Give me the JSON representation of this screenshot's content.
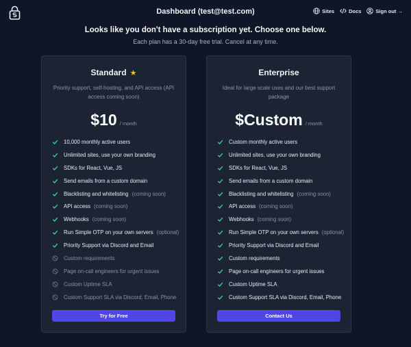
{
  "nav": {
    "title": "Dashboard (test@test.com)",
    "links": [
      {
        "label": "Sites",
        "icon": "globe-icon"
      },
      {
        "label": "Docs",
        "icon": "code-icon"
      },
      {
        "label": "Sign out →",
        "icon": "user-circle-icon"
      }
    ]
  },
  "header": {
    "headline": "Looks like you don't have a subscription yet. Choose one below.",
    "subline": "Each plan has a 30-day free trial. Cancel at any time."
  },
  "colors": {
    "background": "#0f1628",
    "card": "#1c2433",
    "accent": "#4f46e5",
    "check": "#34d399",
    "star": "#f5c518"
  },
  "plans": [
    {
      "name": "Standard",
      "badge_icon": "star-icon",
      "description": "Priority support, self-hosting, and API access (API access coming soon)",
      "price": "$10",
      "period": "/ month",
      "features": [
        {
          "label": "10,000 monthly active users",
          "included": true,
          "note": ""
        },
        {
          "label": "Unlimited sites, use your own branding",
          "included": true,
          "note": ""
        },
        {
          "label": "SDKs for React, Vue, JS",
          "included": true,
          "note": ""
        },
        {
          "label": "Send emails from a custom domain",
          "included": true,
          "note": ""
        },
        {
          "label": "Blacklisting and whitelisting",
          "included": true,
          "note": "(coming soon)"
        },
        {
          "label": "API access",
          "included": true,
          "note": "(coming soon)"
        },
        {
          "label": "Webhooks",
          "included": true,
          "note": "(coming soon)"
        },
        {
          "label": "Run Simple OTP on your own servers",
          "included": true,
          "note": "(optional)"
        },
        {
          "label": "Priority Support via Discord and Email",
          "included": true,
          "note": ""
        },
        {
          "label": "Custom requirements",
          "included": false,
          "note": ""
        },
        {
          "label": "Page on-call engineers for urgent issues",
          "included": false,
          "note": ""
        },
        {
          "label": "Custom Uptime SLA",
          "included": false,
          "note": ""
        },
        {
          "label": "Custom Support SLA via Discord, Email, Phone",
          "included": false,
          "note": ""
        }
      ],
      "cta": "Try for Free"
    },
    {
      "name": "Enterprise",
      "badge_icon": "",
      "description": "Ideal for large scale uses and our best support package",
      "price": "$Custom",
      "period": "/ month",
      "features": [
        {
          "label": "Custom monthly active users",
          "included": true,
          "note": ""
        },
        {
          "label": "Unlimited sites, use your own branding",
          "included": true,
          "note": ""
        },
        {
          "label": "SDKs for React, Vue, JS",
          "included": true,
          "note": ""
        },
        {
          "label": "Send emails from a custom domain",
          "included": true,
          "note": ""
        },
        {
          "label": "Blacklisting and whitelisting",
          "included": true,
          "note": "(coming soon)"
        },
        {
          "label": "API access",
          "included": true,
          "note": "(coming soon)"
        },
        {
          "label": "Webhooks",
          "included": true,
          "note": "(coming soon)"
        },
        {
          "label": "Run Simple OTP on your own servers",
          "included": true,
          "note": "(optional)"
        },
        {
          "label": "Priority Support via Discord and Email",
          "included": true,
          "note": ""
        },
        {
          "label": "Custom requirements",
          "included": true,
          "note": ""
        },
        {
          "label": "Page on-call engineers for urgent issues",
          "included": true,
          "note": ""
        },
        {
          "label": "Custom Uptime SLA",
          "included": true,
          "note": ""
        },
        {
          "label": "Custom Support SLA via Discord, Email, Phone",
          "included": true,
          "note": ""
        }
      ],
      "cta": "Contact Us"
    }
  ]
}
